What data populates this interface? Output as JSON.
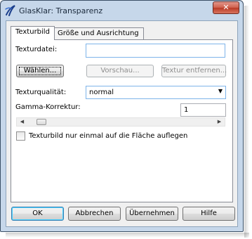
{
  "window": {
    "title": "GlasKlar: Transparenz",
    "close_glyph": "✕",
    "app_icon": "glasklar-logo-icon"
  },
  "tabs": [
    {
      "label": "Texturbild",
      "active": true
    },
    {
      "label": "Größe und Ausrichtung",
      "active": false
    }
  ],
  "texture": {
    "file_label": "Texturdatei:",
    "file_value": "",
    "choose_button": "Wählen...",
    "preview_button": "Vorschau...",
    "remove_button": "Textur entfernen...",
    "quality_label": "Texturqualität:",
    "quality_value": "normal",
    "gamma_label": "Gamma-Korrektur:",
    "gamma_value": "1",
    "gamma_slider_fraction": 0.05,
    "once_checkbox_label": "Texturbild nur einmal auf die Fläche auflegen",
    "once_checked": false
  },
  "footer": {
    "ok": "OK",
    "cancel": "Abbrechen",
    "apply": "Übernehmen",
    "help": "Hilfe"
  },
  "icons": {
    "combo_arrow": "▼",
    "scroll_left": "◀",
    "scroll_right": "▶"
  },
  "colors": {
    "frame": "#c6d7ea",
    "close_button": "#c9503d",
    "focus_border": "#7eb4ea"
  }
}
